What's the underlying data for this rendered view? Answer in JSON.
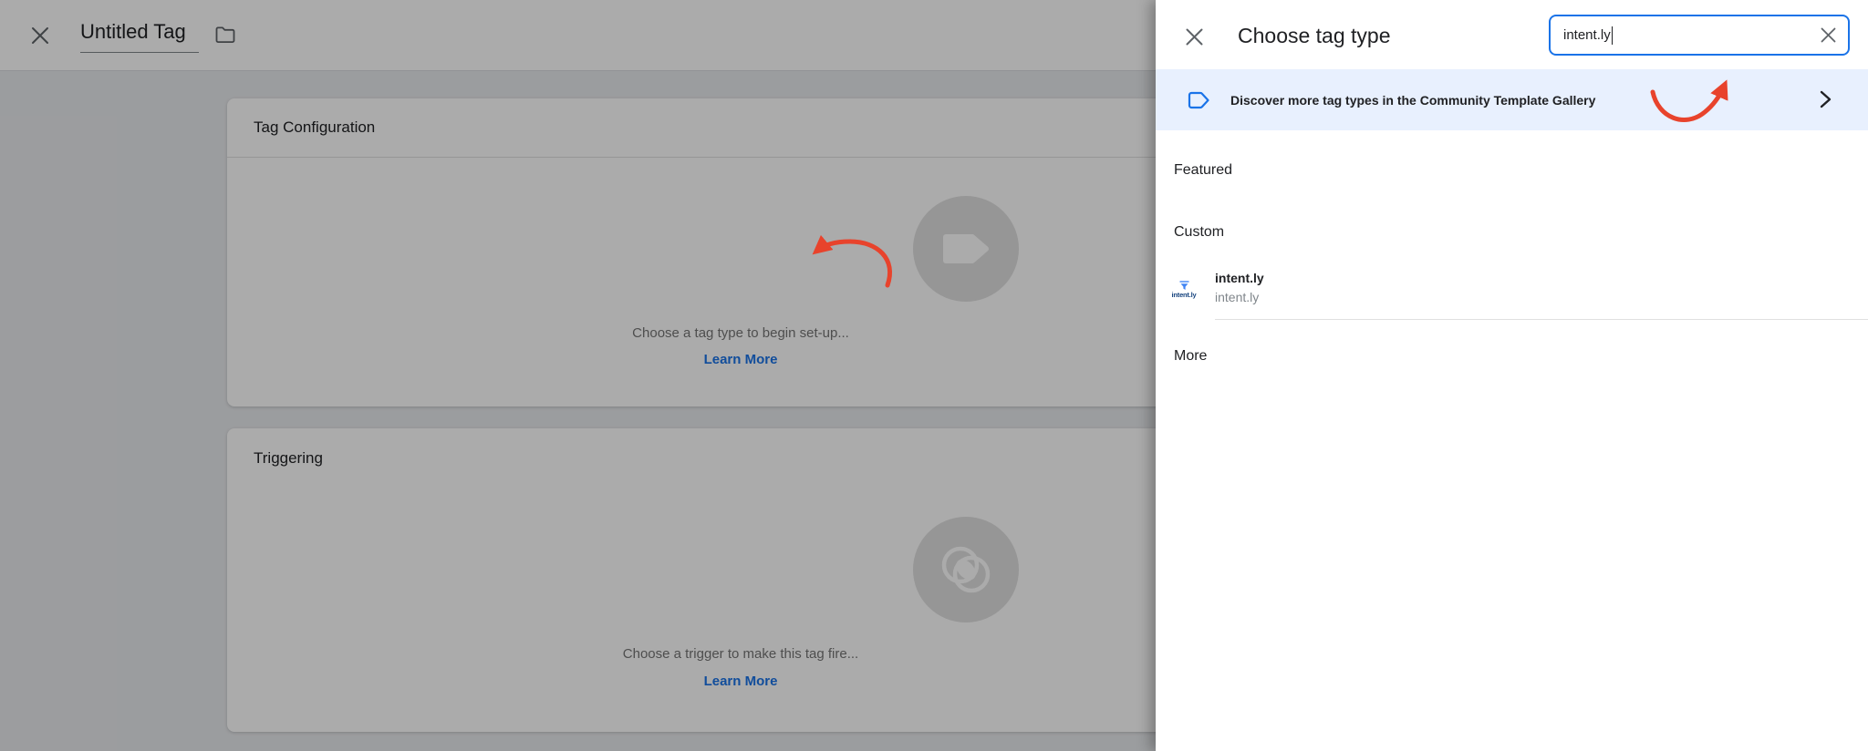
{
  "left_page": {
    "header": {
      "title": "Untitled Tag"
    },
    "tag_config_card": {
      "title": "Tag Configuration",
      "hint": "Choose a tag type to begin set-up...",
      "learn_more": "Learn More"
    },
    "triggering_card": {
      "title": "Triggering",
      "hint": "Choose a trigger to make this tag fire...",
      "learn_more": "Learn More"
    }
  },
  "panel": {
    "title": "Choose tag type",
    "search": {
      "value": "intent.ly"
    },
    "banner": {
      "text": "Discover more tag types in the Community Template Gallery"
    },
    "sections": {
      "featured": "Featured",
      "custom": "Custom",
      "more": "More"
    },
    "custom_items": [
      {
        "title": "intent.ly",
        "subtitle": "intent.ly",
        "logo_text": "intent.ly"
      }
    ]
  },
  "colors": {
    "accent_blue": "#1a73e8",
    "banner_bg": "#e8f0fe",
    "annotation_red": "#e8432c",
    "placeholder_gray": "#e0e0e0"
  }
}
